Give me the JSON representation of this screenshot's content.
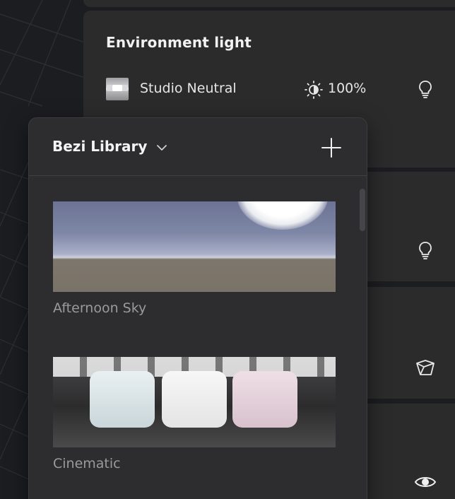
{
  "environment_light": {
    "title": "Environment light",
    "selected_name": "Studio Neutral",
    "intensity": "100%"
  },
  "library": {
    "title": "Bezi Library",
    "items": [
      {
        "label": "Afternoon Sky"
      },
      {
        "label": "Cinematic"
      }
    ]
  },
  "icons": {
    "dropdown": "chevron-down-icon",
    "add": "plus-icon",
    "brightness": "brightness-icon",
    "light": "lightbulb-icon",
    "object": "cube-icon",
    "visibility": "eye-icon"
  },
  "colors": {
    "panel_bg": "#2b2b2b",
    "popover_bg": "#2d2d2f",
    "text_primary": "#f2f2f2",
    "text_secondary": "#9a9a9c"
  }
}
